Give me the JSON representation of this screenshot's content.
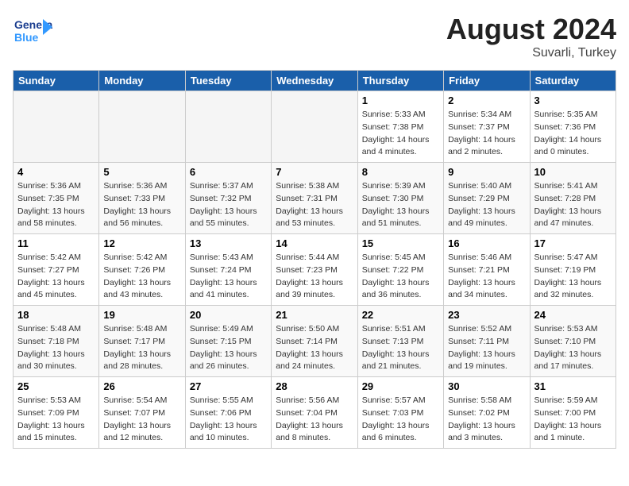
{
  "header": {
    "logo_general": "General",
    "logo_blue": "Blue",
    "month_year": "August 2024",
    "location": "Suvarli, Turkey"
  },
  "weekdays": [
    "Sunday",
    "Monday",
    "Tuesday",
    "Wednesday",
    "Thursday",
    "Friday",
    "Saturday"
  ],
  "weeks": [
    [
      {
        "day": "",
        "info": ""
      },
      {
        "day": "",
        "info": ""
      },
      {
        "day": "",
        "info": ""
      },
      {
        "day": "",
        "info": ""
      },
      {
        "day": "1",
        "info": "Sunrise: 5:33 AM\nSunset: 7:38 PM\nDaylight: 14 hours\nand 4 minutes."
      },
      {
        "day": "2",
        "info": "Sunrise: 5:34 AM\nSunset: 7:37 PM\nDaylight: 14 hours\nand 2 minutes."
      },
      {
        "day": "3",
        "info": "Sunrise: 5:35 AM\nSunset: 7:36 PM\nDaylight: 14 hours\nand 0 minutes."
      }
    ],
    [
      {
        "day": "4",
        "info": "Sunrise: 5:36 AM\nSunset: 7:35 PM\nDaylight: 13 hours\nand 58 minutes."
      },
      {
        "day": "5",
        "info": "Sunrise: 5:36 AM\nSunset: 7:33 PM\nDaylight: 13 hours\nand 56 minutes."
      },
      {
        "day": "6",
        "info": "Sunrise: 5:37 AM\nSunset: 7:32 PM\nDaylight: 13 hours\nand 55 minutes."
      },
      {
        "day": "7",
        "info": "Sunrise: 5:38 AM\nSunset: 7:31 PM\nDaylight: 13 hours\nand 53 minutes."
      },
      {
        "day": "8",
        "info": "Sunrise: 5:39 AM\nSunset: 7:30 PM\nDaylight: 13 hours\nand 51 minutes."
      },
      {
        "day": "9",
        "info": "Sunrise: 5:40 AM\nSunset: 7:29 PM\nDaylight: 13 hours\nand 49 minutes."
      },
      {
        "day": "10",
        "info": "Sunrise: 5:41 AM\nSunset: 7:28 PM\nDaylight: 13 hours\nand 47 minutes."
      }
    ],
    [
      {
        "day": "11",
        "info": "Sunrise: 5:42 AM\nSunset: 7:27 PM\nDaylight: 13 hours\nand 45 minutes."
      },
      {
        "day": "12",
        "info": "Sunrise: 5:42 AM\nSunset: 7:26 PM\nDaylight: 13 hours\nand 43 minutes."
      },
      {
        "day": "13",
        "info": "Sunrise: 5:43 AM\nSunset: 7:24 PM\nDaylight: 13 hours\nand 41 minutes."
      },
      {
        "day": "14",
        "info": "Sunrise: 5:44 AM\nSunset: 7:23 PM\nDaylight: 13 hours\nand 39 minutes."
      },
      {
        "day": "15",
        "info": "Sunrise: 5:45 AM\nSunset: 7:22 PM\nDaylight: 13 hours\nand 36 minutes."
      },
      {
        "day": "16",
        "info": "Sunrise: 5:46 AM\nSunset: 7:21 PM\nDaylight: 13 hours\nand 34 minutes."
      },
      {
        "day": "17",
        "info": "Sunrise: 5:47 AM\nSunset: 7:19 PM\nDaylight: 13 hours\nand 32 minutes."
      }
    ],
    [
      {
        "day": "18",
        "info": "Sunrise: 5:48 AM\nSunset: 7:18 PM\nDaylight: 13 hours\nand 30 minutes."
      },
      {
        "day": "19",
        "info": "Sunrise: 5:48 AM\nSunset: 7:17 PM\nDaylight: 13 hours\nand 28 minutes."
      },
      {
        "day": "20",
        "info": "Sunrise: 5:49 AM\nSunset: 7:15 PM\nDaylight: 13 hours\nand 26 minutes."
      },
      {
        "day": "21",
        "info": "Sunrise: 5:50 AM\nSunset: 7:14 PM\nDaylight: 13 hours\nand 24 minutes."
      },
      {
        "day": "22",
        "info": "Sunrise: 5:51 AM\nSunset: 7:13 PM\nDaylight: 13 hours\nand 21 minutes."
      },
      {
        "day": "23",
        "info": "Sunrise: 5:52 AM\nSunset: 7:11 PM\nDaylight: 13 hours\nand 19 minutes."
      },
      {
        "day": "24",
        "info": "Sunrise: 5:53 AM\nSunset: 7:10 PM\nDaylight: 13 hours\nand 17 minutes."
      }
    ],
    [
      {
        "day": "25",
        "info": "Sunrise: 5:53 AM\nSunset: 7:09 PM\nDaylight: 13 hours\nand 15 minutes."
      },
      {
        "day": "26",
        "info": "Sunrise: 5:54 AM\nSunset: 7:07 PM\nDaylight: 13 hours\nand 12 minutes."
      },
      {
        "day": "27",
        "info": "Sunrise: 5:55 AM\nSunset: 7:06 PM\nDaylight: 13 hours\nand 10 minutes."
      },
      {
        "day": "28",
        "info": "Sunrise: 5:56 AM\nSunset: 7:04 PM\nDaylight: 13 hours\nand 8 minutes."
      },
      {
        "day": "29",
        "info": "Sunrise: 5:57 AM\nSunset: 7:03 PM\nDaylight: 13 hours\nand 6 minutes."
      },
      {
        "day": "30",
        "info": "Sunrise: 5:58 AM\nSunset: 7:02 PM\nDaylight: 13 hours\nand 3 minutes."
      },
      {
        "day": "31",
        "info": "Sunrise: 5:59 AM\nSunset: 7:00 PM\nDaylight: 13 hours\nand 1 minute."
      }
    ]
  ]
}
